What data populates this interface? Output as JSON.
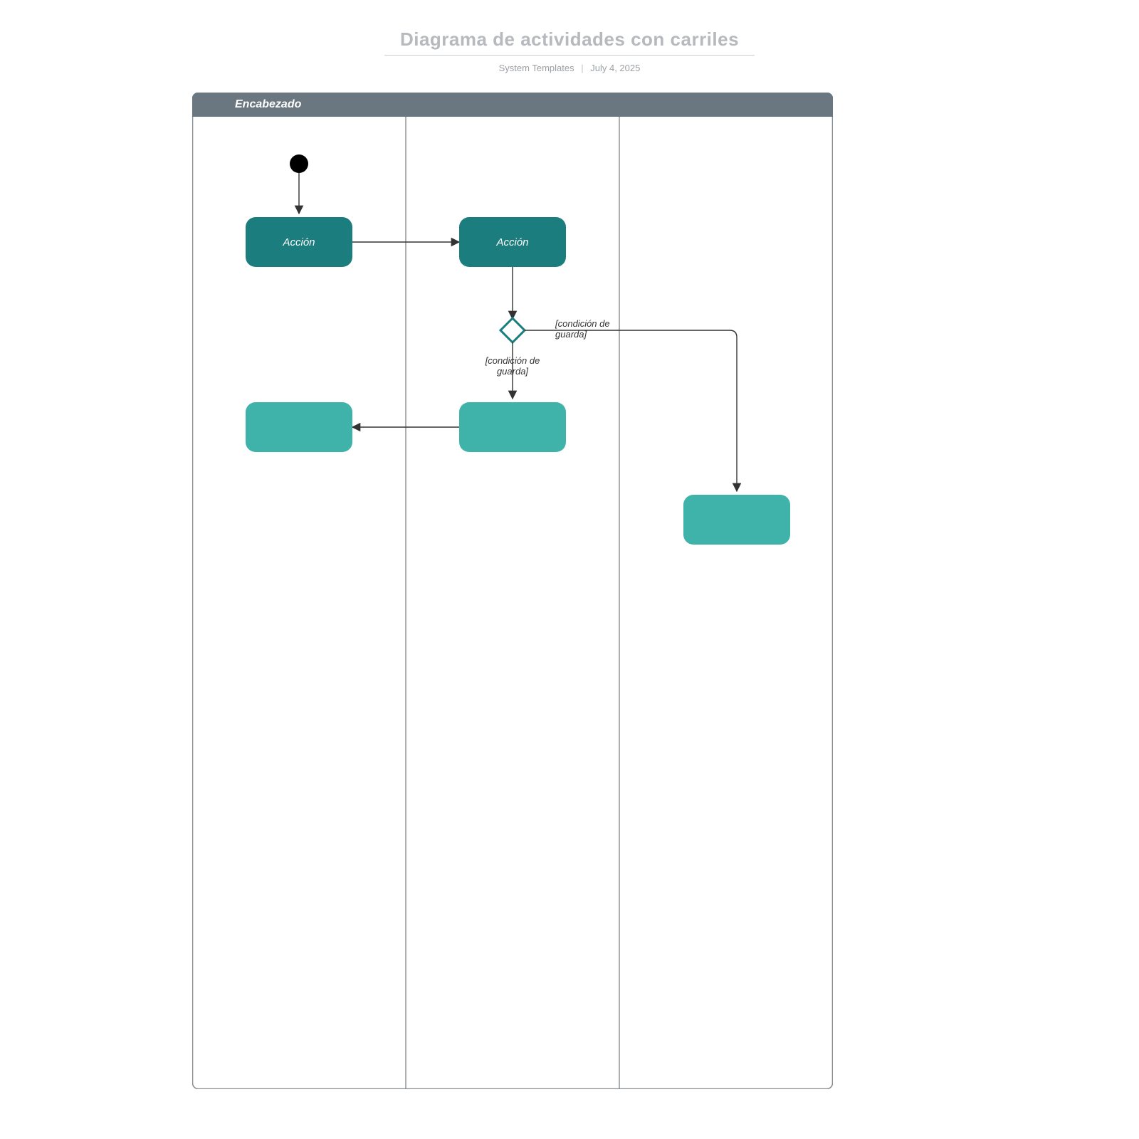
{
  "header": {
    "title": "Diagrama de actividades con carriles",
    "subtitle_author": "System Templates",
    "subtitle_date": "July 4, 2025"
  },
  "swimlane": {
    "header_label": "Encabezado",
    "lane_count": 3
  },
  "nodes": {
    "start": {
      "type": "initial"
    },
    "action1": {
      "label": "Acción"
    },
    "action2": {
      "label": "Acción"
    },
    "decision": {
      "type": "decision"
    },
    "action3": {
      "label": ""
    },
    "action4": {
      "label": ""
    },
    "action5": {
      "label": ""
    }
  },
  "guards": {
    "guard_down": "[condición de\nguarda]",
    "guard_right": "[condición de\nguarda]"
  },
  "colors": {
    "teal_dark": "#1b7d7d",
    "teal_light": "#3fb3a9",
    "header_bar": "#6b7780",
    "lane_border": "#888d92"
  }
}
